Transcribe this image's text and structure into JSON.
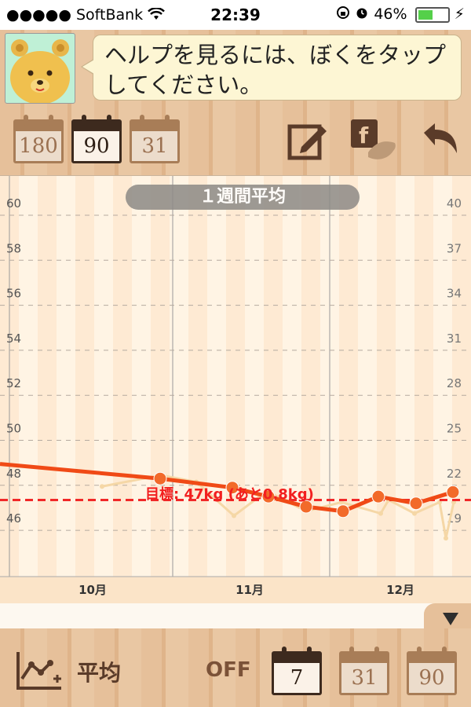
{
  "status_bar": {
    "signal": "●●●●●",
    "carrier": "SoftBank",
    "wifi_icon": "wifi-icon",
    "time": "22:39",
    "lock_icon": "rotation-lock-icon",
    "alarm_icon": "alarm-icon",
    "battery": "46%"
  },
  "help_bubble": {
    "text_line1": "ヘルプを見るには、ぼくをタップ",
    "text_line2": "してください。"
  },
  "toolbar": {
    "range_buttons": [
      "180",
      "90",
      "31"
    ],
    "selected_range": "90",
    "edit_icon": "edit-icon",
    "share_icon": "facebook-twitter-icon",
    "back_icon": "back-arrow-icon"
  },
  "chart_title": "１週間平均",
  "goal_label": "目標: 47kg (あと0.8kg)",
  "chart_data": {
    "type": "line",
    "y_left_ticks": [
      "60",
      "58",
      "56",
      "54",
      "52",
      "50",
      "48",
      "46"
    ],
    "y_right_ticks": [
      "40",
      "37",
      "34",
      "31",
      "28",
      "25",
      "22",
      "19"
    ],
    "x_labels": [
      "10月",
      "11月",
      "12月"
    ],
    "ylim": [
      45.8,
      60
    ],
    "goal": 47,
    "series": [
      {
        "values": [
          48.6,
          47.95,
          47.55,
          47.15,
          46.7,
          46.5,
          47.15,
          46.85,
          47.35
        ]
      },
      {
        "values": [
          47.6,
          48.1,
          47.8,
          46.3,
          47.4,
          46.5,
          46.9,
          46.4,
          47.0,
          46.4,
          46.9,
          45.3,
          46.9
        ]
      }
    ],
    "colors": {
      "avg_line": "#f04a16",
      "avg_point": "#f26a2a",
      "daily_line": "#f5d7a6",
      "goal_line": "#f02828"
    }
  },
  "footer": {
    "graph_icon": "graph-plus-icon",
    "avg_label": "平均",
    "toggle": "OFF",
    "avg_buttons": [
      "7",
      "31",
      "90"
    ],
    "selected_avg": "7"
  },
  "collapse_icon": "triangle-down-icon"
}
